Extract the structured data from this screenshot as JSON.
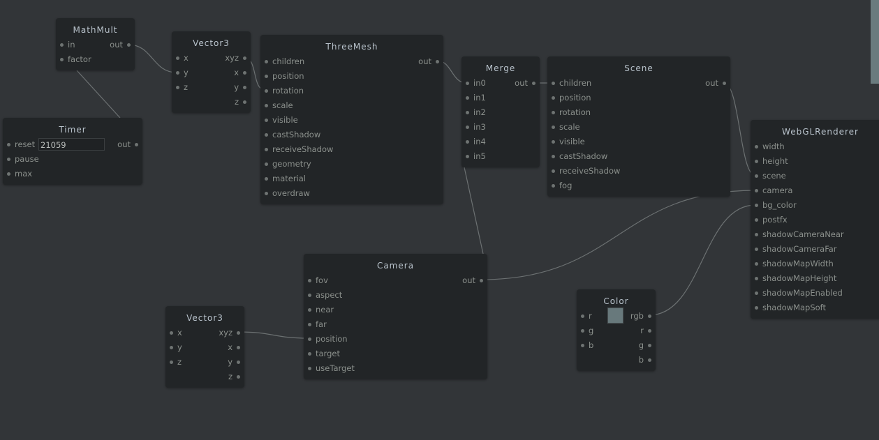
{
  "nodes": [
    {
      "title": "MathMult",
      "inputs": [
        "in",
        "factor"
      ],
      "outputs": [
        "out"
      ]
    },
    {
      "title": "Vector3",
      "inputs": [
        "x",
        "y",
        "z"
      ],
      "outputs": [
        "xyz",
        "x",
        "y",
        "z"
      ]
    },
    {
      "title": "ThreeMesh",
      "inputs": [
        "children",
        "position",
        "rotation",
        "scale",
        "visible",
        "castShadow",
        "receiveShadow",
        "geometry",
        "material",
        "overdraw"
      ],
      "outputs": [
        "out"
      ]
    },
    {
      "title": "Merge",
      "inputs": [
        "in0",
        "in1",
        "in2",
        "in3",
        "in4",
        "in5"
      ],
      "outputs": [
        "out"
      ]
    },
    {
      "title": "Scene",
      "inputs": [
        "children",
        "position",
        "rotation",
        "scale",
        "visible",
        "castShadow",
        "receiveShadow",
        "fog"
      ],
      "outputs": [
        "out"
      ]
    },
    {
      "title": "WebGLRenderer",
      "inputs": [
        "width",
        "height",
        "scene",
        "camera",
        "bg_color",
        "postfx",
        "shadowCameraNear",
        "shadowCameraFar",
        "shadowMapWidth",
        "shadowMapHeight",
        "shadowMapEnabled",
        "shadowMapSoft"
      ],
      "outputs": []
    },
    {
      "title": "Timer",
      "inputs": [
        "reset",
        "pause",
        "max"
      ],
      "outputs": [
        "out"
      ],
      "field_value": "21059"
    },
    {
      "title": "Camera",
      "inputs": [
        "fov",
        "aspect",
        "near",
        "far",
        "position",
        "target",
        "useTarget"
      ],
      "outputs": [
        "out"
      ]
    },
    {
      "title": "Vector3",
      "inputs": [
        "x",
        "y",
        "z"
      ],
      "outputs": [
        "xyz",
        "x",
        "y",
        "z"
      ]
    },
    {
      "title": "Color",
      "inputs": [
        "r",
        "g",
        "b"
      ],
      "outputs": [
        "rgb",
        "r",
        "g",
        "b"
      ],
      "swatch_color": "#68797c"
    }
  ],
  "colors": {
    "background": "#323538",
    "node": "#222527",
    "wire": "#6c7172"
  }
}
